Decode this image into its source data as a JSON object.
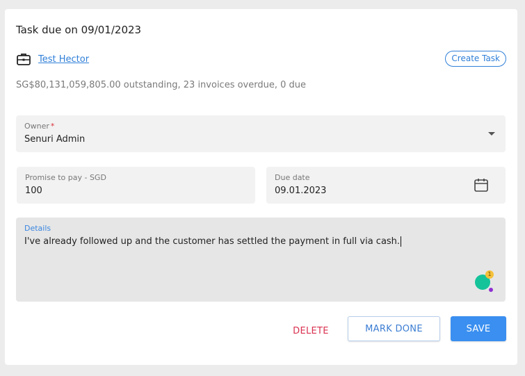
{
  "task": {
    "title": "Task due on 09/01/2023"
  },
  "customer": {
    "icon": "briefcase-icon",
    "name": "Test Hector"
  },
  "create_task_label": "Create Task",
  "summary": "SG$80,131,059,805.00 outstanding, 23 invoices overdue, 0 due",
  "owner": {
    "label": "Owner",
    "required_mark": "*",
    "value": "Senuri Admin",
    "icon": "chevron-down-icon"
  },
  "promise_to_pay": {
    "label": "Promise to pay - SGD",
    "value": "100"
  },
  "due_date": {
    "label": "Due date",
    "value": "09.01.2023",
    "icon": "calendar-icon"
  },
  "details": {
    "label": "Details",
    "value": "I've already followed up and the customer has settled the payment in full via cash."
  },
  "assistant_badge": {
    "icon": "grammar-assistant-icon",
    "count": "1"
  },
  "actions": {
    "delete_label": "DELETE",
    "mark_done_label": "MARK DONE",
    "save_label": "SAVE"
  },
  "colors": {
    "accent": "#3a8ff0",
    "link": "#2f7fd8",
    "danger": "#d9304f",
    "field_bg": "#f2f2f2",
    "details_bg": "#e6e6e6",
    "assistant_green": "#15c39a"
  }
}
